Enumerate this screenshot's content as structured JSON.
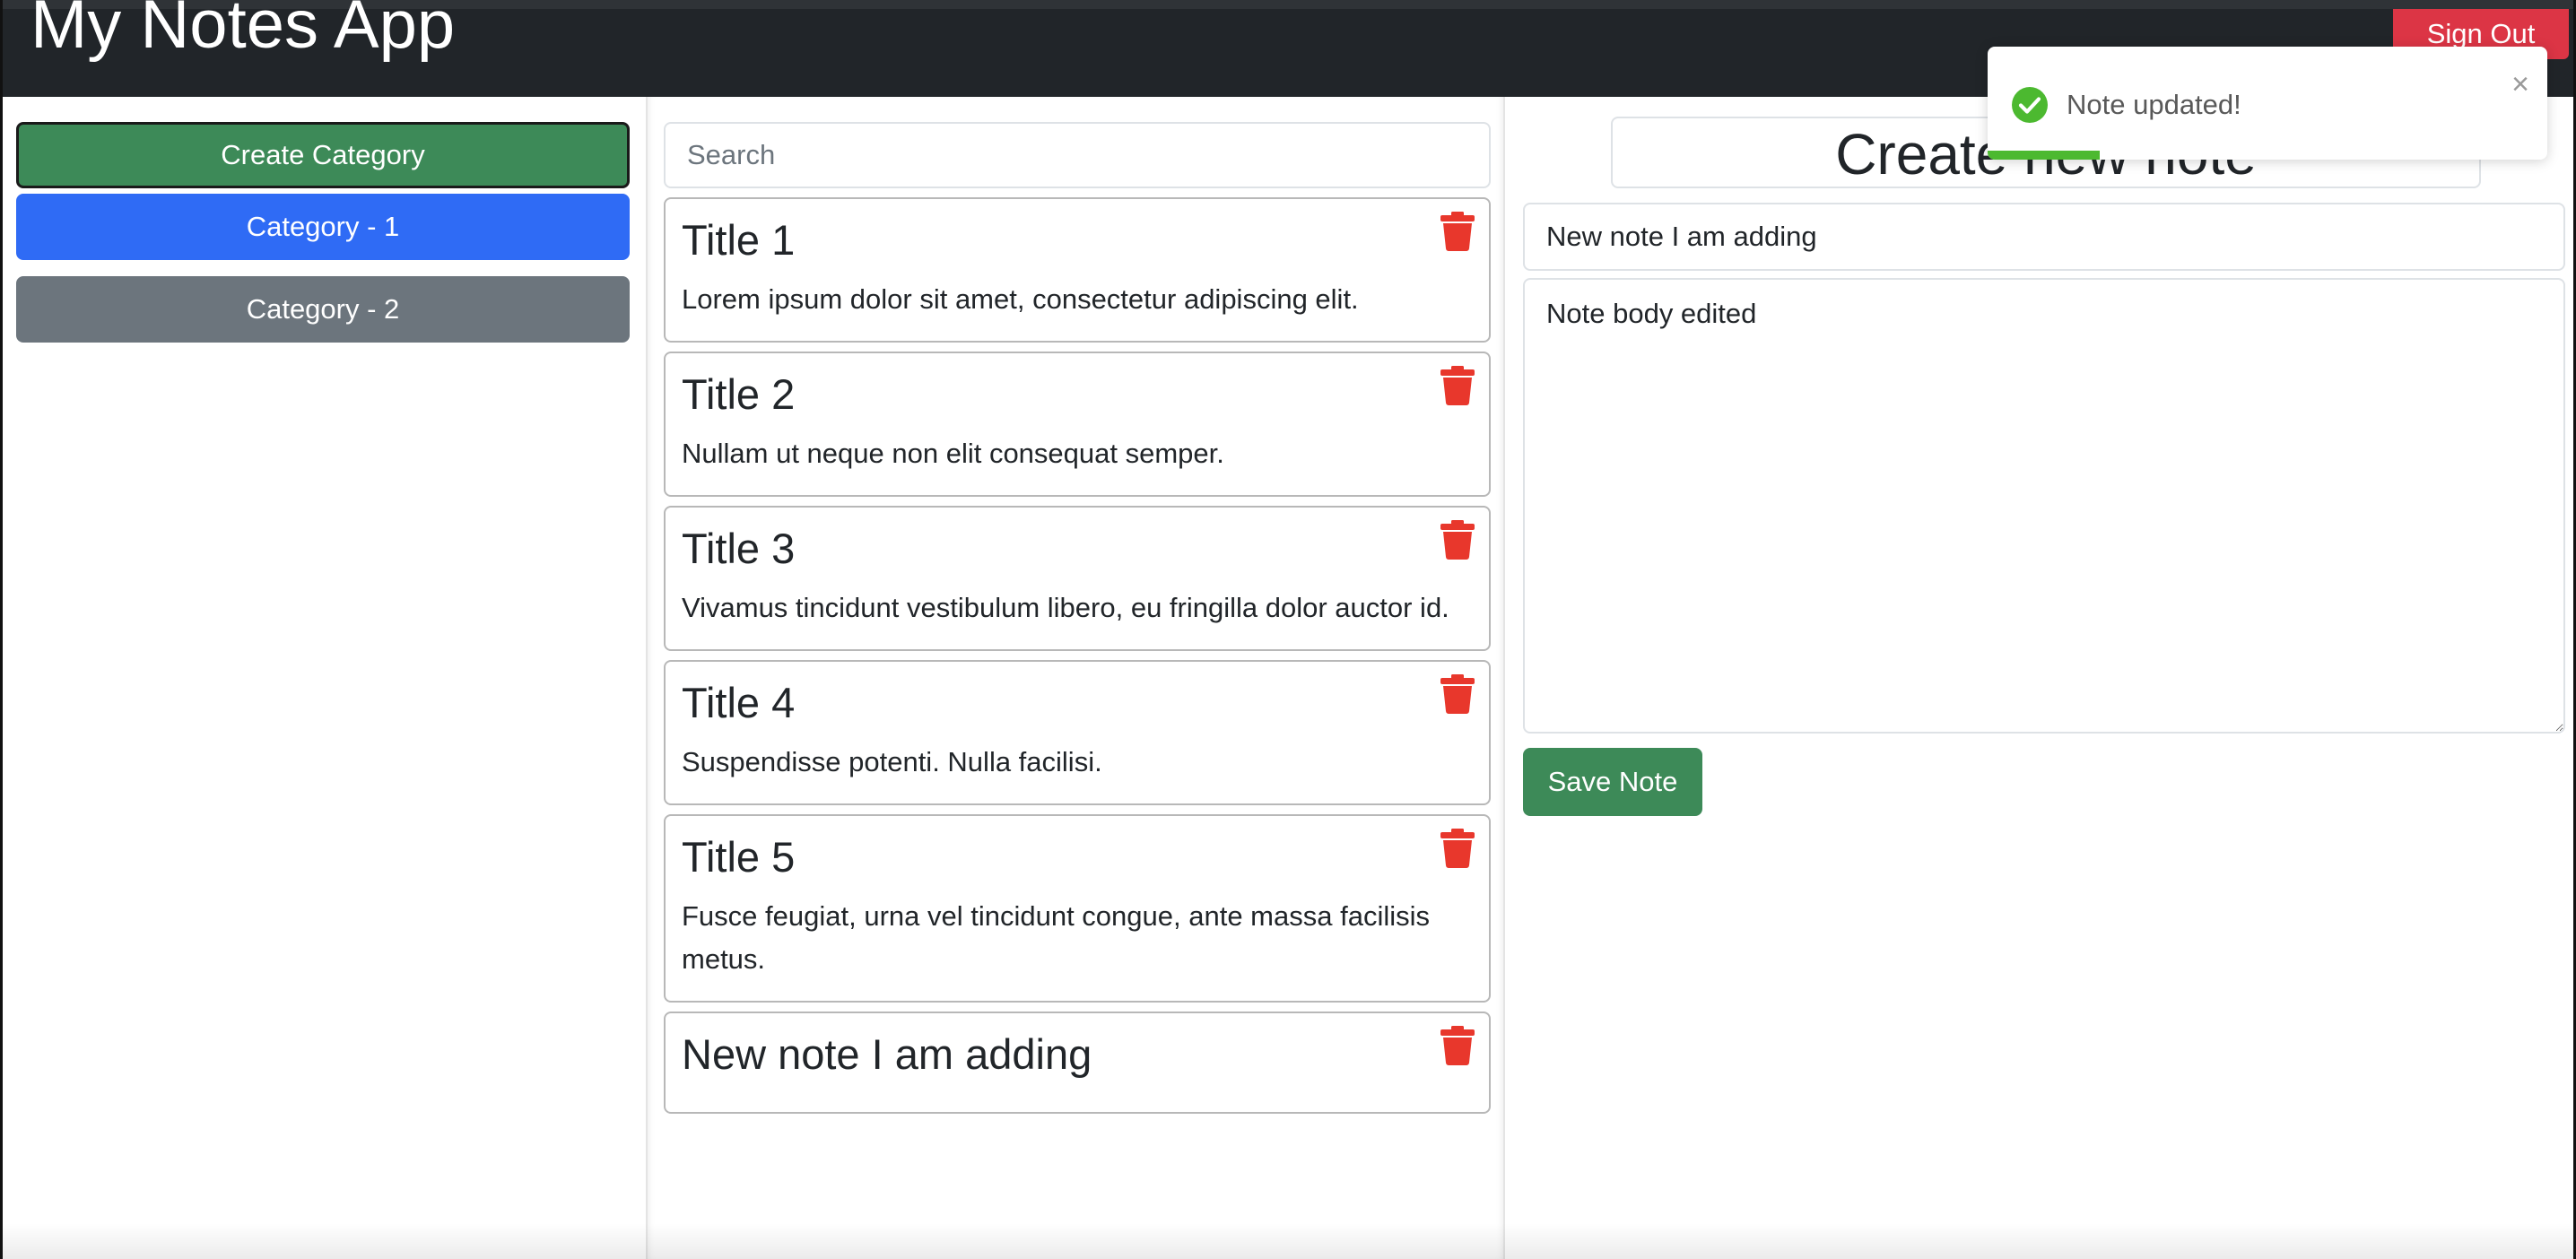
{
  "navbar": {
    "brand": "My Notes App",
    "signout_label": "Sign Out"
  },
  "sidebar": {
    "create_label": "Create Category",
    "categories": [
      {
        "label": "Category - 1",
        "active": true
      },
      {
        "label": "Category - 2",
        "active": false
      }
    ]
  },
  "notes": {
    "search_placeholder": "Search",
    "items": [
      {
        "title": "Title 1",
        "body": "Lorem ipsum dolor sit amet, consectetur adipiscing elit."
      },
      {
        "title": "Title 2",
        "body": "Nullam ut neque non elit consequat semper."
      },
      {
        "title": "Title 3",
        "body": "Vivamus tincidunt vestibulum libero, eu fringilla dolor auctor id."
      },
      {
        "title": "Title 4",
        "body": "Suspendisse potenti. Nulla facilisi."
      },
      {
        "title": "Title 5",
        "body": "Fusce feugiat, urna vel tincidunt congue, ante massa facilisis metus."
      },
      {
        "title": "New note I am adding",
        "body": ""
      }
    ]
  },
  "editor": {
    "heading": "Create new note",
    "title_value": "New note I am adding",
    "body_value": "Note body edited",
    "save_label": "Save Note"
  },
  "toast": {
    "message": "Note updated!",
    "close_glyph": "×",
    "progress": 0.2
  },
  "colors": {
    "navbar": "#212529",
    "success": "#3d8a58",
    "primary": "#2f6bf5",
    "secondary": "#6c757d",
    "danger": "#dc3545",
    "trash": "#e8372c",
    "toast_green": "#4cb930"
  }
}
